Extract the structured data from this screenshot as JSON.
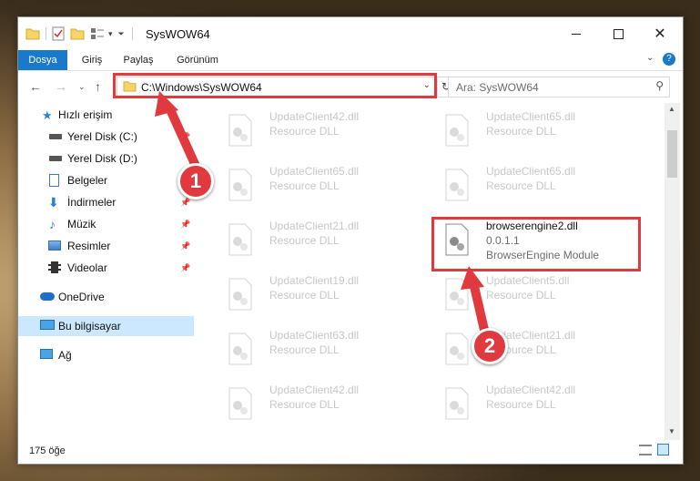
{
  "window": {
    "title": "SysWOW64"
  },
  "ribbon": {
    "tabs": [
      "Dosya",
      "Giriş",
      "Paylaş",
      "Görünüm"
    ]
  },
  "address": {
    "path": "C:\\Windows\\SysWOW64"
  },
  "search": {
    "placeholder": "Ara: SysWOW64"
  },
  "nav": {
    "items": [
      {
        "label": "Hızlı erişim",
        "icon": "star-icon"
      },
      {
        "label": "Yerel Disk (C:)",
        "icon": "drive-icon"
      },
      {
        "label": "Yerel Disk (D:)",
        "icon": "drive-icon"
      },
      {
        "label": "Belgeler",
        "icon": "document-icon"
      },
      {
        "label": "İndirmeler",
        "icon": "download-icon"
      },
      {
        "label": "Müzik",
        "icon": "music-icon"
      },
      {
        "label": "Resimler",
        "icon": "pictures-icon"
      },
      {
        "label": "Videolar",
        "icon": "video-icon"
      },
      {
        "label": "OneDrive",
        "icon": "cloud-icon"
      },
      {
        "label": "Bu bilgisayar",
        "icon": "computer-icon"
      },
      {
        "label": "Ağ",
        "icon": "network-icon"
      }
    ]
  },
  "files": {
    "col1": [
      {
        "name": "UpdateClient42.dll",
        "type": "Resource DLL"
      },
      {
        "name": "UpdateClient65.dll",
        "type": "Resource DLL"
      },
      {
        "name": "UpdateClient21.dll",
        "type": "Resource DLL"
      },
      {
        "name": "UpdateClient19.dll",
        "type": "Resource DLL"
      },
      {
        "name": "UpdateClient63.dll",
        "type": "Resource DLL"
      },
      {
        "name": "UpdateClient42.dll",
        "type": "Resource DLL"
      }
    ],
    "col2": [
      {
        "name": "UpdateClient65.dll",
        "type": "Resource DLL"
      },
      {
        "name": "UpdateClient65.dll",
        "type": "Resource DLL"
      },
      {
        "name": "UpdateClient5.dll",
        "type": "Resource DLL"
      },
      {
        "name": "UpdateClient21.dll",
        "type": "Resource DLL"
      },
      {
        "name": "UpdateClient42.dll",
        "type": "Resource DLL"
      }
    ],
    "highlight": {
      "name": "browserengine2.dll",
      "version": "0.0.1.1",
      "description": "BrowserEngine Module"
    }
  },
  "status": {
    "count": "175 öğe"
  },
  "annotations": {
    "badge1": "1",
    "badge2": "2",
    "color": "#e0393e"
  }
}
